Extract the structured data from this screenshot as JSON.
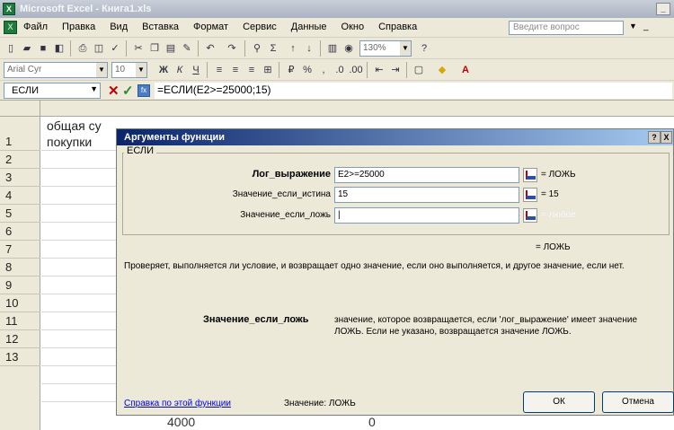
{
  "window": {
    "title": "Microsoft Excel - Книга1.xls"
  },
  "menubar": {
    "items": [
      "Файл",
      "Правка",
      "Вид",
      "Вставка",
      "Формат",
      "Сервис",
      "Данные",
      "Окно",
      "Справка"
    ],
    "help_placeholder": "Введите вопрос"
  },
  "toolbar": {
    "zoom": "130%",
    "font": "Arial Cyr",
    "font_size": "10"
  },
  "formula_bar": {
    "name_box": "ЕСЛИ",
    "formula": "=ЕСЛИ(E2>=25000;15)"
  },
  "sheet": {
    "cell_a_row0": "общая су",
    "cell_a_row1": "покупки",
    "rows": [
      "1",
      "2",
      "3",
      "4",
      "5",
      "6",
      "7",
      "8",
      "9",
      "10",
      "11",
      "12",
      "13"
    ],
    "row13_b": "4000",
    "row13_c": "0"
  },
  "dialog": {
    "title": "Аргументы функции",
    "function_name": "ЕСЛИ",
    "args": [
      {
        "label": "Лог_выражение",
        "value": "E2>=25000",
        "result": "= ЛОЖЬ"
      },
      {
        "label": "Значение_если_истина",
        "value": "15",
        "result": "= 15"
      },
      {
        "label": "Значение_если_ложь",
        "value": "",
        "result": "= любое"
      }
    ],
    "result": "= ЛОЖЬ",
    "description": "Проверяет, выполняется ли условие, и возвращает одно значение, если оно выполняется, и другое значение, если нет.",
    "arg_desc_name": "Значение_если_ложь",
    "arg_desc_text": "значение, которое возвращается, если 'лог_выражение' имеет значение ЛОЖЬ. Если не указано, возвращается значение ЛОЖЬ.",
    "help_link": "Справка по этой функции",
    "value_line": "Значение: ЛОЖЬ",
    "ok": "ОК",
    "cancel": "Отмена",
    "help_btn": "?",
    "close_btn": "X"
  }
}
